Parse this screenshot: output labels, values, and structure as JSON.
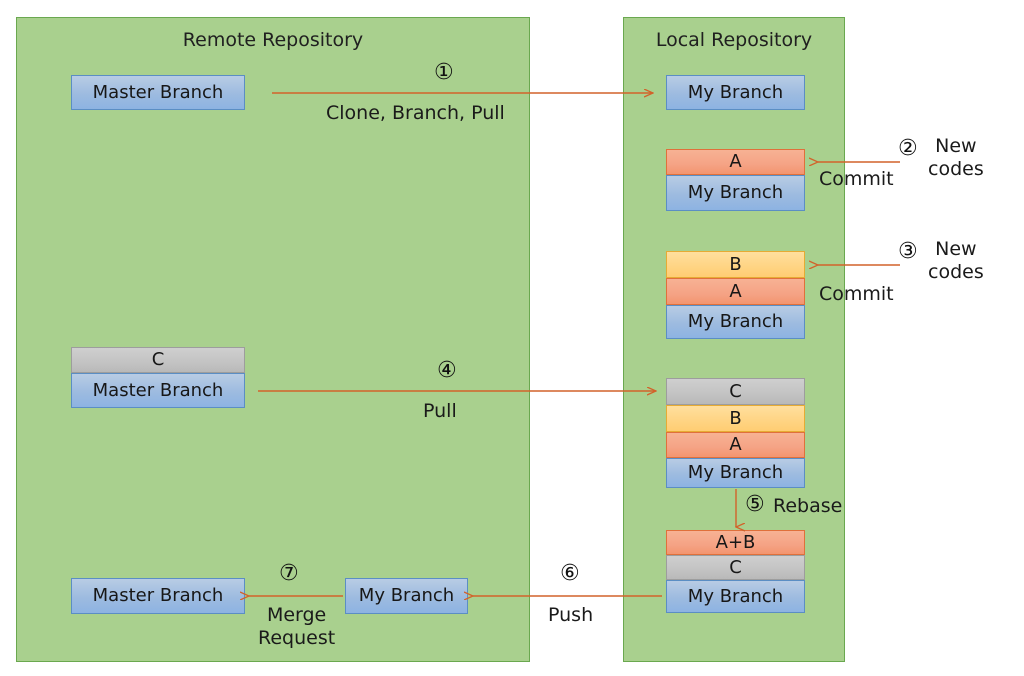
{
  "diagram": {
    "title_remote": "Remote Repository",
    "title_local": "Local Repository"
  },
  "remote": {
    "master_top": "Master Branch",
    "c_commit": "C",
    "master_mid": "Master Branch",
    "master_bottom": "Master Branch",
    "my_branch_bottom": "My Branch"
  },
  "local": {
    "my_branch_1": "My Branch",
    "a_commit_1": "A",
    "my_branch_2": "My Branch",
    "b_commit_1": "B",
    "a_commit_2": "A",
    "my_branch_3": "My Branch",
    "c_commit_1": "C",
    "b_commit_2": "B",
    "a_commit_3": "A",
    "my_branch_4": "My Branch",
    "ab_commit": "A+B",
    "c_commit_2": "C",
    "my_branch_5": "My Branch"
  },
  "steps": [
    {
      "num": "①",
      "label": "Clone, Branch, Pull"
    },
    {
      "num": "②",
      "label": "Commit",
      "note": "New\ncodes"
    },
    {
      "num": "③",
      "label": "Commit",
      "note": "New\ncodes"
    },
    {
      "num": "④",
      "label": "Pull"
    },
    {
      "num": "⑤",
      "label": "Rebase"
    },
    {
      "num": "⑥",
      "label": "Push"
    },
    {
      "num": "⑦",
      "label": "Merge\nRequest"
    }
  ],
  "colors": {
    "panel_fill": "#a9d08e",
    "panel_border": "#6aa84f",
    "branch_blue": "#8db3e2",
    "commit_orange": "#f3956f",
    "commit_yellow": "#ffcd73",
    "commit_gray": "#bfbfbf",
    "arrow": "#d2622a"
  }
}
